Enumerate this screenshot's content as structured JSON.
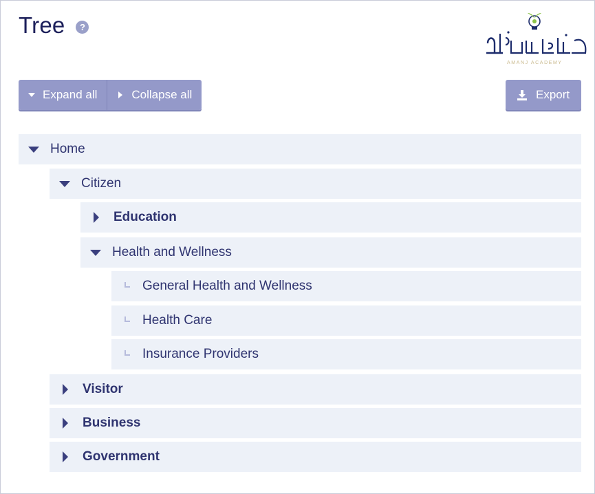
{
  "header": {
    "title": "Tree",
    "help_symbol": "?"
  },
  "logo": {
    "caption": "AMANJ ACADEMY",
    "accent_green": "#8bc34a",
    "ink": "#1c2b6b"
  },
  "toolbar": {
    "expand_all_label": "Expand all",
    "collapse_all_label": "Collapse all",
    "export_label": "Export"
  },
  "tree": {
    "home": "Home",
    "citizen": "Citizen",
    "education": "Education",
    "health_and_wellness": "Health and Wellness",
    "general_health": "General Health and Wellness",
    "health_care": "Health Care",
    "insurance_providers": "Insurance Providers",
    "visitor": "Visitor",
    "business": "Business",
    "government": "Government"
  },
  "colors": {
    "button_bg": "#9499c9",
    "row_bg": "#edf1f8",
    "text": "#2f3470"
  }
}
